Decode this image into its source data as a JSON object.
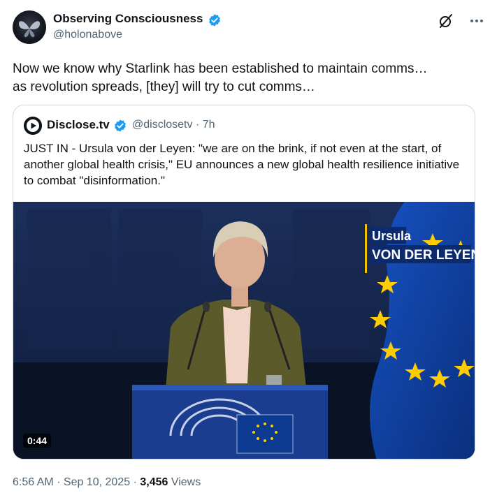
{
  "author": {
    "name": "Observing Consciousness",
    "handle": "@holonabove"
  },
  "tweet": {
    "text": "Now we know why Starlink has been established to maintain comms…\nas revolution spreads, [they] will try to cut comms…"
  },
  "quote": {
    "name": "Disclose.tv",
    "handle_time": "@disclosetv · 7h",
    "text": "JUST IN - Ursula von der Leyen: \"we are on the brink, if not even at the start, of another global health crisis,\" EU announces a new global health resilience initiative to combat \"disinformation.\"",
    "video": {
      "lower_third_first": "Ursula",
      "lower_third_last": "VON DER LEYEN",
      "duration": "0:44"
    }
  },
  "meta": {
    "time_date": "6:56 AM · Sep 10, 2025 · ",
    "views_count": "3,456",
    "views_label": " Views"
  },
  "colors": {
    "verified": "#1d9bf0",
    "eu_blue": "#0c3a91",
    "eu_star": "#ffcc00",
    "jacket": "#5a5a2a"
  },
  "icons": [
    "verified-badge-icon",
    "grok-icon",
    "more-icon",
    "play-logo-icon"
  ]
}
